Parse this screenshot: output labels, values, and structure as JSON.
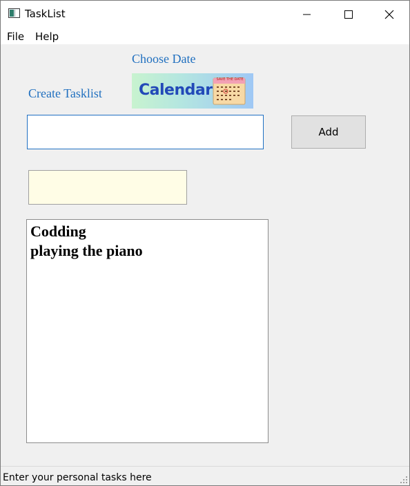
{
  "window": {
    "title": "TaskList",
    "controls": {
      "minimize": "minimize-icon",
      "maximize": "maximize-icon",
      "close": "close-icon"
    }
  },
  "menu": {
    "items": [
      "File",
      "Help"
    ]
  },
  "main": {
    "choose_date_label": "Choose Date",
    "create_tasklist_label": "Create Tasklist",
    "calendar_button": {
      "text": "Calendar",
      "caption": "SAVE THE DATE",
      "icon": "calendar-icon"
    },
    "task_input": {
      "value": "",
      "placeholder": ""
    },
    "add_button_label": "Add",
    "date_field_value": "",
    "tasks": [
      "Codding",
      "playing the piano"
    ]
  },
  "status_bar": {
    "text": "Enter your personal tasks here"
  },
  "colors": {
    "label_blue": "#1f6fbf",
    "input_border": "#1e6fc2",
    "date_field_bg": "#fffde6",
    "calendar_text": "#2249b8"
  }
}
